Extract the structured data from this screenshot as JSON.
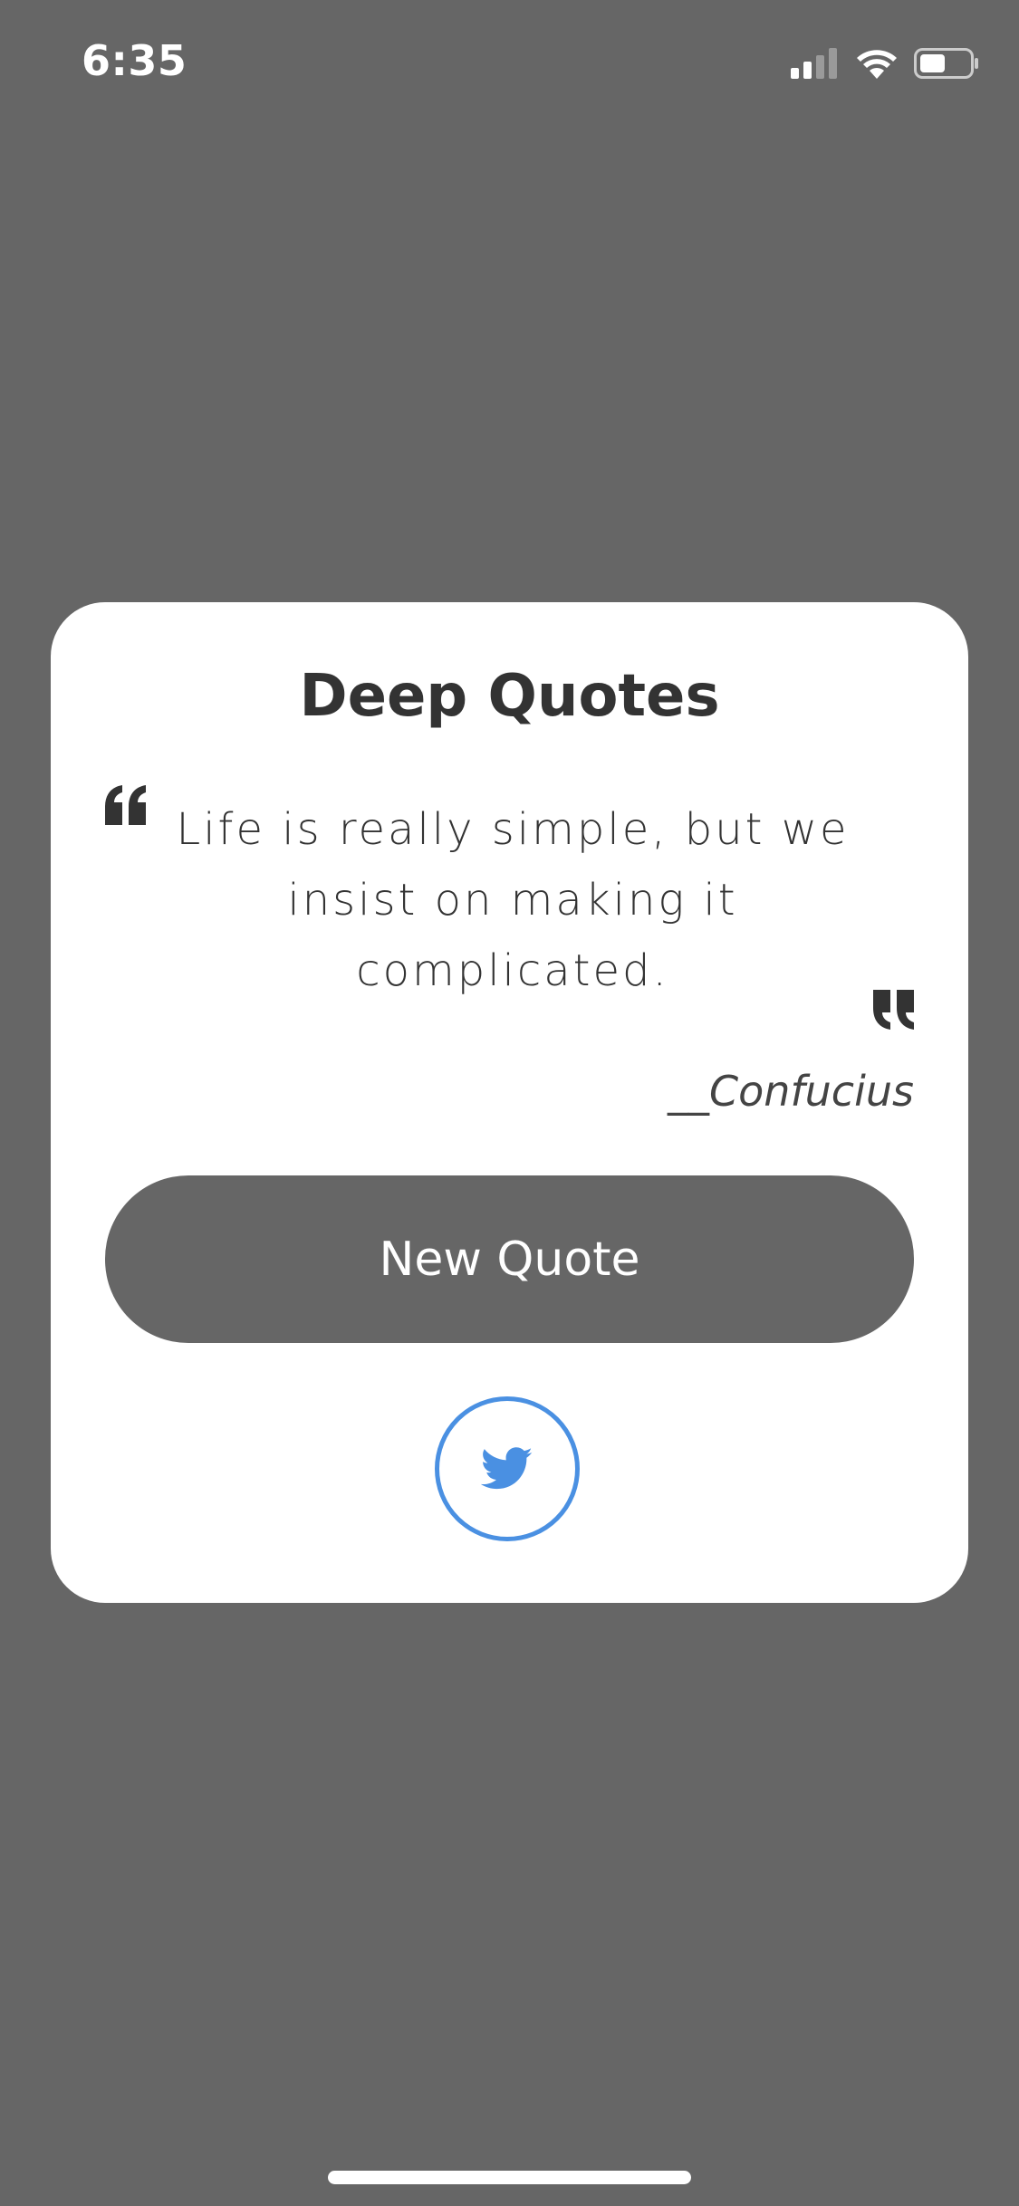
{
  "status_bar": {
    "time": "6:35"
  },
  "icons": {
    "signal": "cellular-signal-icon",
    "wifi": "wifi-icon",
    "battery": "battery-icon",
    "open_quote": "open-quote-icon",
    "close_quote": "close-quote-icon",
    "twitter": "twitter-bird-icon"
  },
  "card": {
    "title": "Deep Quotes",
    "quote_text": "Life is really simple, but we insist on making it complicated.",
    "author": "__Confucius",
    "new_quote_label": "New Quote"
  },
  "colors": {
    "background": "#666666",
    "card": "#ffffff",
    "button": "#666666",
    "twitter": "#4a90e2",
    "text": "#333333"
  }
}
